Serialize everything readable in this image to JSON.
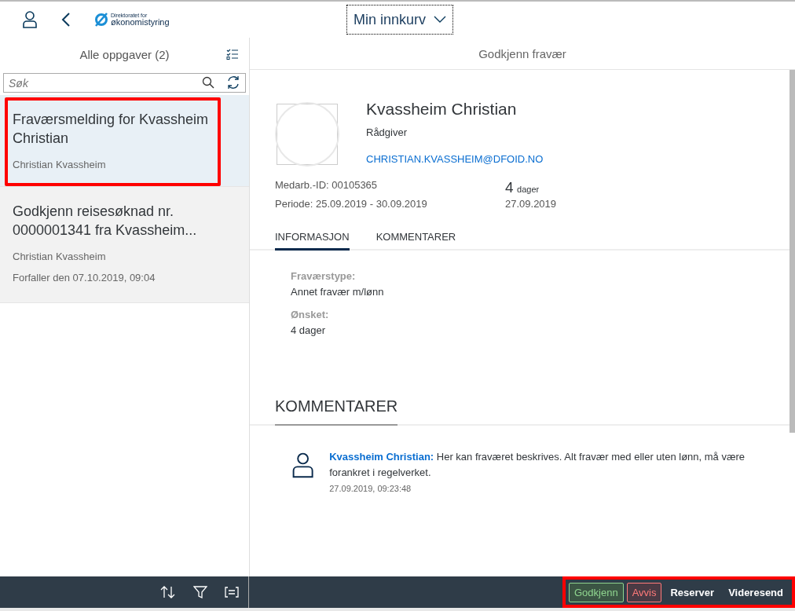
{
  "top_bar": {
    "logo": {
      "line1": "Direktoratet for",
      "line2": "økonomistyring"
    },
    "view_selector": "Min innkurv"
  },
  "task_list": {
    "title": "Alle oppgaver (2)",
    "search": {
      "placeholder": "Søk"
    },
    "items": [
      {
        "title": "Fraværsmelding for Kvassheim Christian",
        "lines": [
          "Christian Kvassheim"
        ],
        "selected": true,
        "highlighted": true
      },
      {
        "title": "Godkjenn reisesøknad nr. 0000001341 fra Kvassheim...",
        "lines": [
          "Christian Kvassheim",
          "Forfaller den 07.10.2019, 09:04"
        ],
        "selected": false,
        "highlighted": false
      }
    ]
  },
  "detail": {
    "title": "Godkjenn fravær",
    "name": "Kvassheim Christian",
    "role": "Rådgiver",
    "email": "CHRISTIAN.KVASSHEIM@DFOID.NO",
    "attributes": [
      "Medarb.-ID: 00105365",
      "Periode: 25.09.2019 - 30.09.2019"
    ],
    "number": {
      "value": "4",
      "unit": "dager",
      "date": "27.09.2019"
    },
    "tabs": [
      {
        "label": "INFORMASJON",
        "selected": true
      },
      {
        "label": "KOMMENTARER",
        "selected": false
      }
    ],
    "fields": [
      {
        "label": "Fraværstype:",
        "value": "Annet fravær m/lønn"
      },
      {
        "label": "Ønsket:",
        "value": "4 dager"
      }
    ],
    "comments_heading": "KOMMENTARER",
    "comments": [
      {
        "author": "Kvassheim Christian:",
        "text": "Her kan fraværet beskrives. Alt fravær med eller uten lønn, må være forankret i regelverket.",
        "time": "27.09.2019, 09:23:48"
      }
    ]
  },
  "footer": {
    "actions_highlighted": true,
    "actions": [
      {
        "label": "Godkjenn",
        "kind": "accept"
      },
      {
        "label": "Avvis",
        "kind": "reject"
      },
      {
        "label": "Reserver",
        "kind": "plain"
      },
      {
        "label": "Videresend",
        "kind": "plain"
      }
    ]
  }
}
